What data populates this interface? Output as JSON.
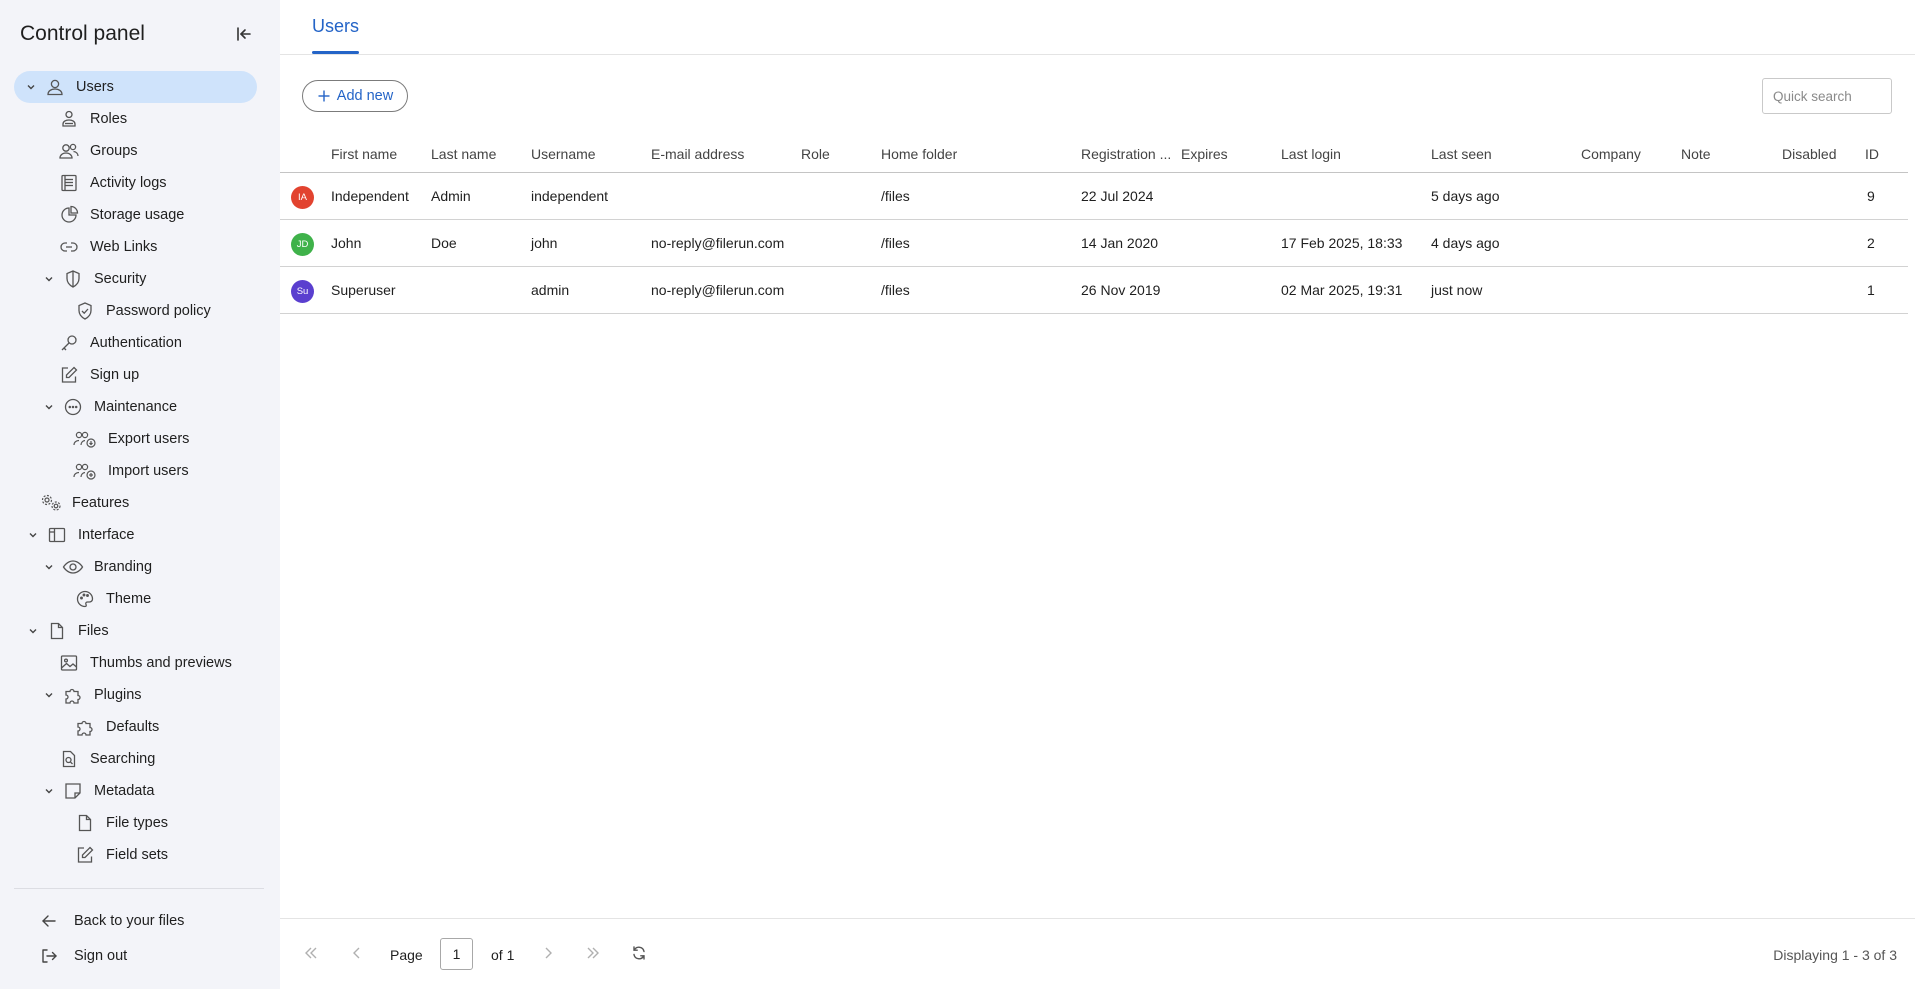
{
  "sidebar": {
    "title": "Control panel",
    "items": [
      {
        "label": "Users"
      },
      {
        "label": "Roles"
      },
      {
        "label": "Groups"
      },
      {
        "label": "Activity logs"
      },
      {
        "label": "Storage usage"
      },
      {
        "label": "Web Links"
      },
      {
        "label": "Security"
      },
      {
        "label": "Password policy"
      },
      {
        "label": "Authentication"
      },
      {
        "label": "Sign up"
      },
      {
        "label": "Maintenance"
      },
      {
        "label": "Export users"
      },
      {
        "label": "Import users"
      },
      {
        "label": "Features"
      },
      {
        "label": "Interface"
      },
      {
        "label": "Branding"
      },
      {
        "label": "Theme"
      },
      {
        "label": "Files"
      },
      {
        "label": "Thumbs and previews"
      },
      {
        "label": "Plugins"
      },
      {
        "label": "Defaults"
      },
      {
        "label": "Searching"
      },
      {
        "label": "Metadata"
      },
      {
        "label": "File types"
      },
      {
        "label": "Field sets"
      }
    ],
    "back_label": "Back to your files",
    "signout_label": "Sign out"
  },
  "header": {
    "tab_label": "Users"
  },
  "toolbar": {
    "add_label": "Add new",
    "search_placeholder": "Quick search"
  },
  "table": {
    "columns": [
      "First name",
      "Last name",
      "Username",
      "E-mail address",
      "Role",
      "Home folder",
      "Registration ...",
      "Expires",
      "Last login",
      "Last seen",
      "Company",
      "Note",
      "Disabled",
      "ID"
    ],
    "rows": [
      {
        "initials": "IA",
        "avatar_color": "#e2432f",
        "first": "Independent",
        "last": "Admin",
        "username": "independent",
        "email": "",
        "role": "",
        "home": "/files",
        "registered": "22 Jul 2024",
        "expires": "",
        "last_login": "",
        "last_seen": "5 days ago",
        "company": "",
        "note": "",
        "disabled": "",
        "id": "9"
      },
      {
        "initials": "JD",
        "avatar_color": "#3fb24a",
        "first": "John",
        "last": "Doe",
        "username": "john",
        "email": "no-reply@filerun.com",
        "role": "",
        "home": "/files",
        "registered": "14 Jan 2020",
        "expires": "",
        "last_login": "17 Feb 2025, 18:33",
        "last_seen": "4 days ago",
        "company": "",
        "note": "",
        "disabled": "",
        "id": "2"
      },
      {
        "initials": "Su",
        "avatar_color": "#5a3fcf",
        "first": "Superuser",
        "last": "",
        "username": "admin",
        "email": "no-reply@filerun.com",
        "role": "",
        "home": "/files",
        "registered": "26 Nov 2019",
        "expires": "",
        "last_login": "02 Mar 2025, 19:31",
        "last_seen": "just now",
        "company": "",
        "note": "",
        "disabled": "",
        "id": "1"
      }
    ]
  },
  "pager": {
    "page_label": "Page",
    "page_value": "1",
    "of_label": "of 1",
    "displaying": "Displaying 1 - 3 of 3"
  },
  "colors": {
    "accent": "#2464c7",
    "active_item_bg": "#cfe3fb",
    "sidebar_bg": "#f3f4f9"
  },
  "icons": {
    "sidebar": [
      "user-icon",
      "roles-icon",
      "groups-icon",
      "activity-logs-icon",
      "storage-usage-icon",
      "web-links-icon",
      "shield-icon",
      "shield-check-icon",
      "key-icon",
      "sign-up-icon",
      "more-circle-icon",
      "export-users-icon",
      "import-users-icon",
      "features-gear-icon",
      "interface-layout-icon",
      "eye-icon",
      "palette-icon",
      "file-icon",
      "image-icon",
      "puzzle-icon",
      "puzzle-defaults-icon",
      "search-file-icon",
      "metadata-note-icon",
      "file-types-icon",
      "edit-icon"
    ]
  }
}
